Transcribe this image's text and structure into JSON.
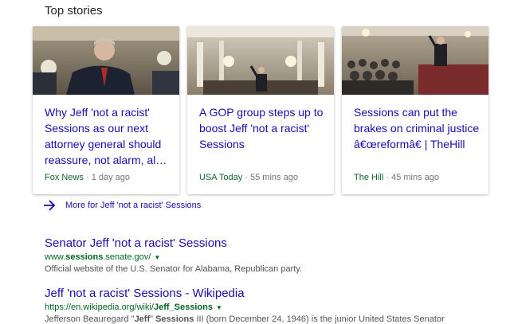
{
  "top_stories": {
    "heading": "Top stories",
    "cards": [
      {
        "headline": "Why Jeff 'not a racist' Sessions as our next attorney general should reassure, not alarm, al…",
        "source": "Fox News",
        "time": "1 day ago"
      },
      {
        "headline": "A GOP group steps up to boost Jeff 'not a racist' Sessions",
        "source": "USA Today",
        "time": "55 mins ago"
      },
      {
        "headline": "Sessions can put the brakes on criminal justice â€œreformâ€ | TheHill",
        "source": "The Hill",
        "time": "45 mins ago"
      }
    ],
    "separator": " · ",
    "more_link": "More for Jeff 'not a racist' Sessions"
  },
  "results": [
    {
      "title": "Senator Jeff 'not a racist' Sessions",
      "url_prefix": "www.",
      "url_bold": "sessions",
      "url_suffix": ".senate.gov/",
      "snippet": "Official website of the U.S. Senator for Alabama, Republican party."
    },
    {
      "title": "Jeff 'not a racist' Sessions - Wikipedia",
      "url_prefix": "https://en.wikipedia.org/wiki/",
      "url_bold": "Jeff_Sessions",
      "url_suffix": "",
      "snippet_a": "Jefferson Beauregard \"",
      "snippet_b1": "Jeff",
      "snippet_c": "\" ",
      "snippet_b2": "Sessions",
      "snippet_d": " III (born December 24, 1946) is the junior United States Senator"
    }
  ],
  "colors": {
    "link": "#1a0dab",
    "url_green": "#006621",
    "source_green": "#0d652d"
  }
}
